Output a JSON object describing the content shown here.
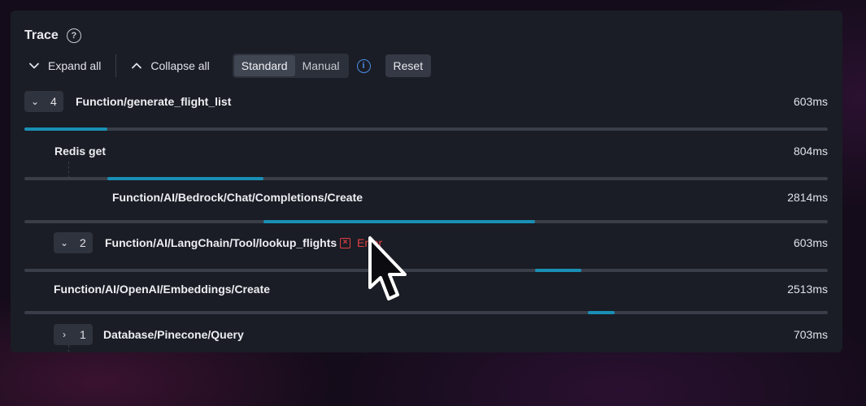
{
  "panel": {
    "title": "Trace"
  },
  "toolbar": {
    "expand_label": "Expand all",
    "collapse_label": "Collapse all",
    "mode_standard": "Standard",
    "mode_manual": "Manual",
    "reset_label": "Reset"
  },
  "spans": [
    {
      "name": "Function/generate_flight_list",
      "duration": "603ms",
      "count": "4",
      "expanded": true
    },
    {
      "name": "Redis get",
      "duration": "804ms"
    },
    {
      "name": "Function/AI/Bedrock/Chat/Completions/Create",
      "duration": "2814ms"
    },
    {
      "name": "Function/AI/LangChain/Tool/lookup_flights",
      "duration": "603ms",
      "count": "2",
      "expanded": true,
      "error_label": "Error"
    },
    {
      "name": "Function/AI/OpenAI/Embeddings/Create",
      "duration": "2513ms"
    },
    {
      "name": "Database/Pinecone/Query",
      "duration": "703ms",
      "count": "1",
      "expanded": false
    }
  ],
  "timing_bars": [
    {
      "start_pct": 0.0,
      "end_pct": 10.3
    },
    {
      "start_pct": 10.3,
      "end_pct": 29.8
    },
    {
      "start_pct": 29.8,
      "end_pct": 63.6
    },
    {
      "start_pct": 63.6,
      "end_pct": 69.3
    },
    {
      "start_pct": 70.1,
      "end_pct": 73.5
    }
  ],
  "colors": {
    "accent_bar": "#1a8fb5",
    "error": "#e03f45",
    "info": "#4a8fe8"
  },
  "icons": {
    "help": "question-circle-icon",
    "info": "info-circle-icon",
    "error": "error-x-icon",
    "expand": "chevron-down-icon",
    "collapse": "chevron-up-icon",
    "cursor": "mouse-pointer-icon"
  }
}
